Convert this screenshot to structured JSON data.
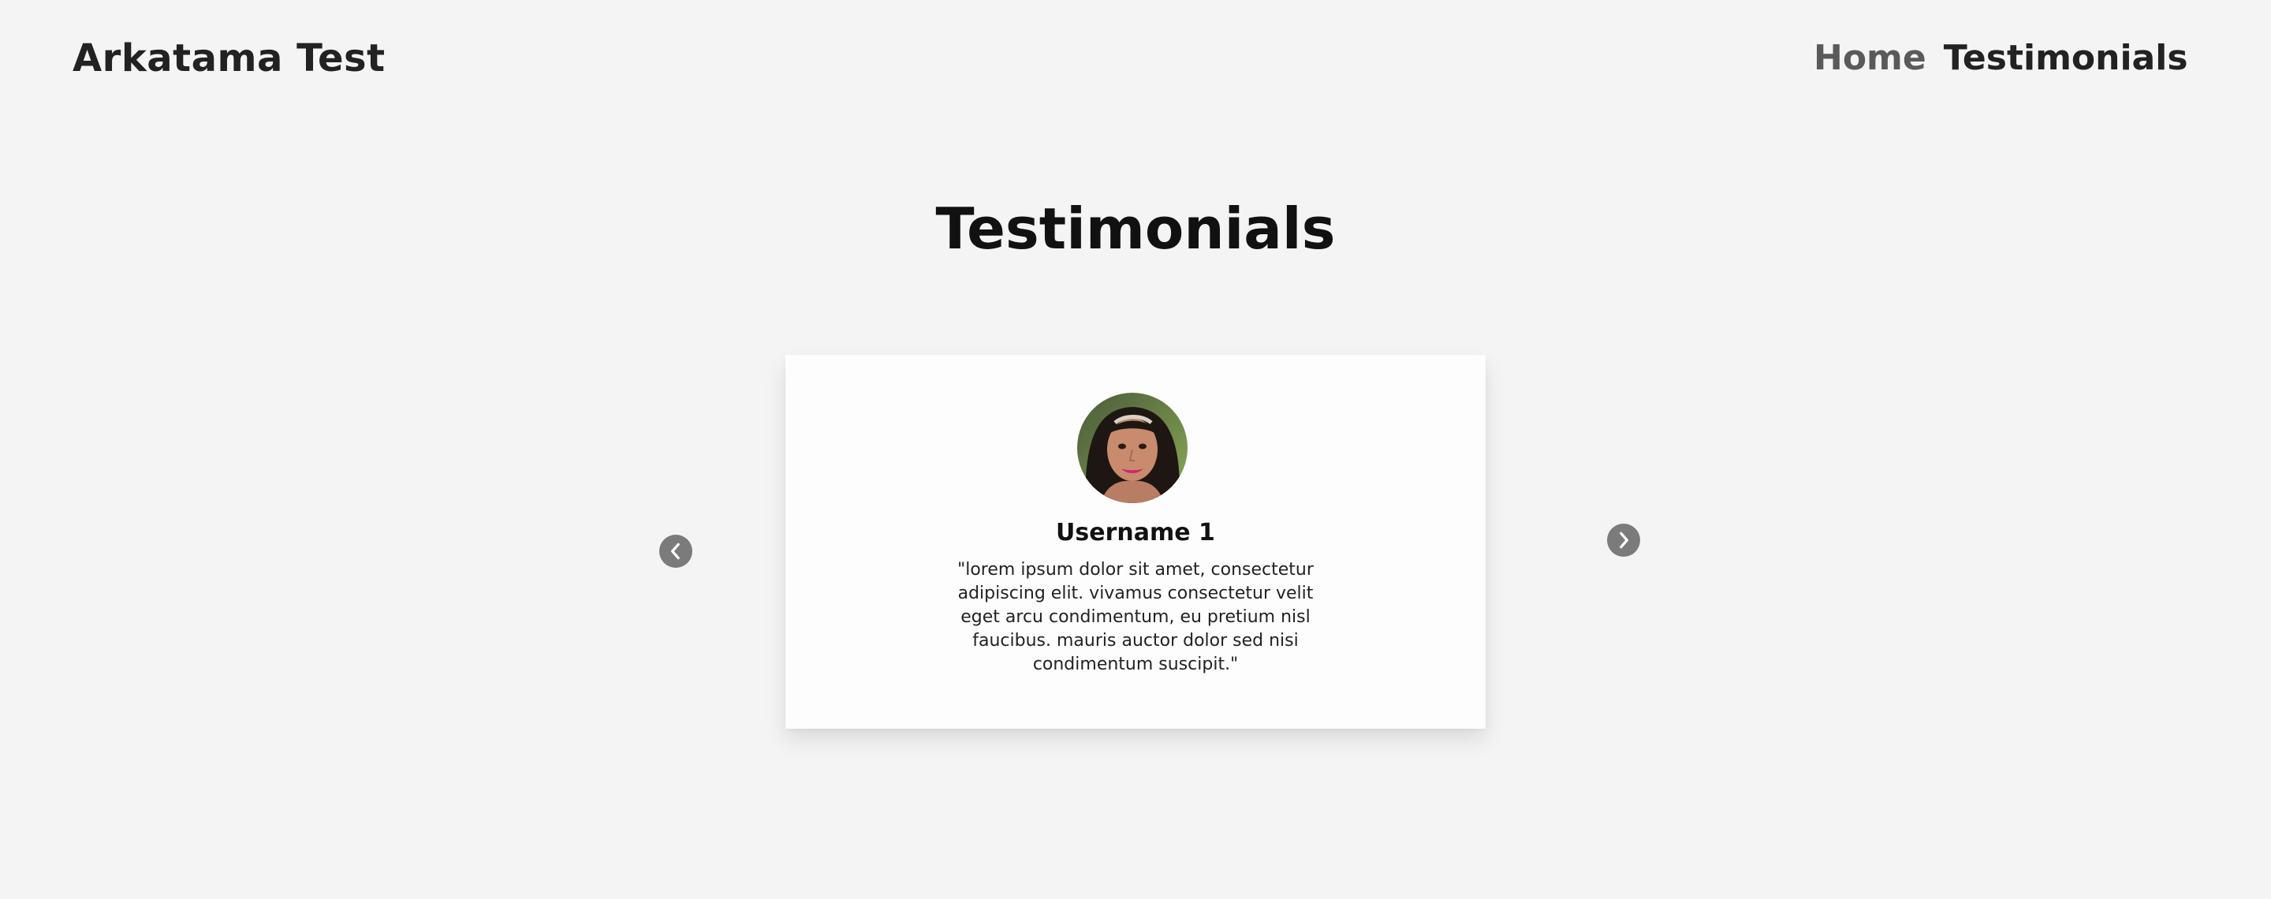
{
  "header": {
    "brand": "Arkatama Test",
    "nav": [
      {
        "label": "Home"
      },
      {
        "label": "Testimonials"
      }
    ]
  },
  "main": {
    "title": "Testimonials",
    "carousel": {
      "prev_icon": "chevron-left-icon",
      "next_icon": "chevron-right-icon",
      "slide": {
        "username": "Username 1",
        "quote": "\"lorem ipsum dolor sit amet, consectetur adipiscing elit. vivamus consectetur velit eget arcu condimentum, eu pretium nisl faucibus. mauris auctor dolor sed nisi condimentum suscipit.\"",
        "avatar": "user-avatar-photo"
      }
    }
  },
  "colors": {
    "background": "#f4f4f4",
    "card": "#fdfdfd",
    "arrow": "#7b7b7b",
    "nav_inactive": "#5a5a5a",
    "text_dark": "#222222"
  }
}
